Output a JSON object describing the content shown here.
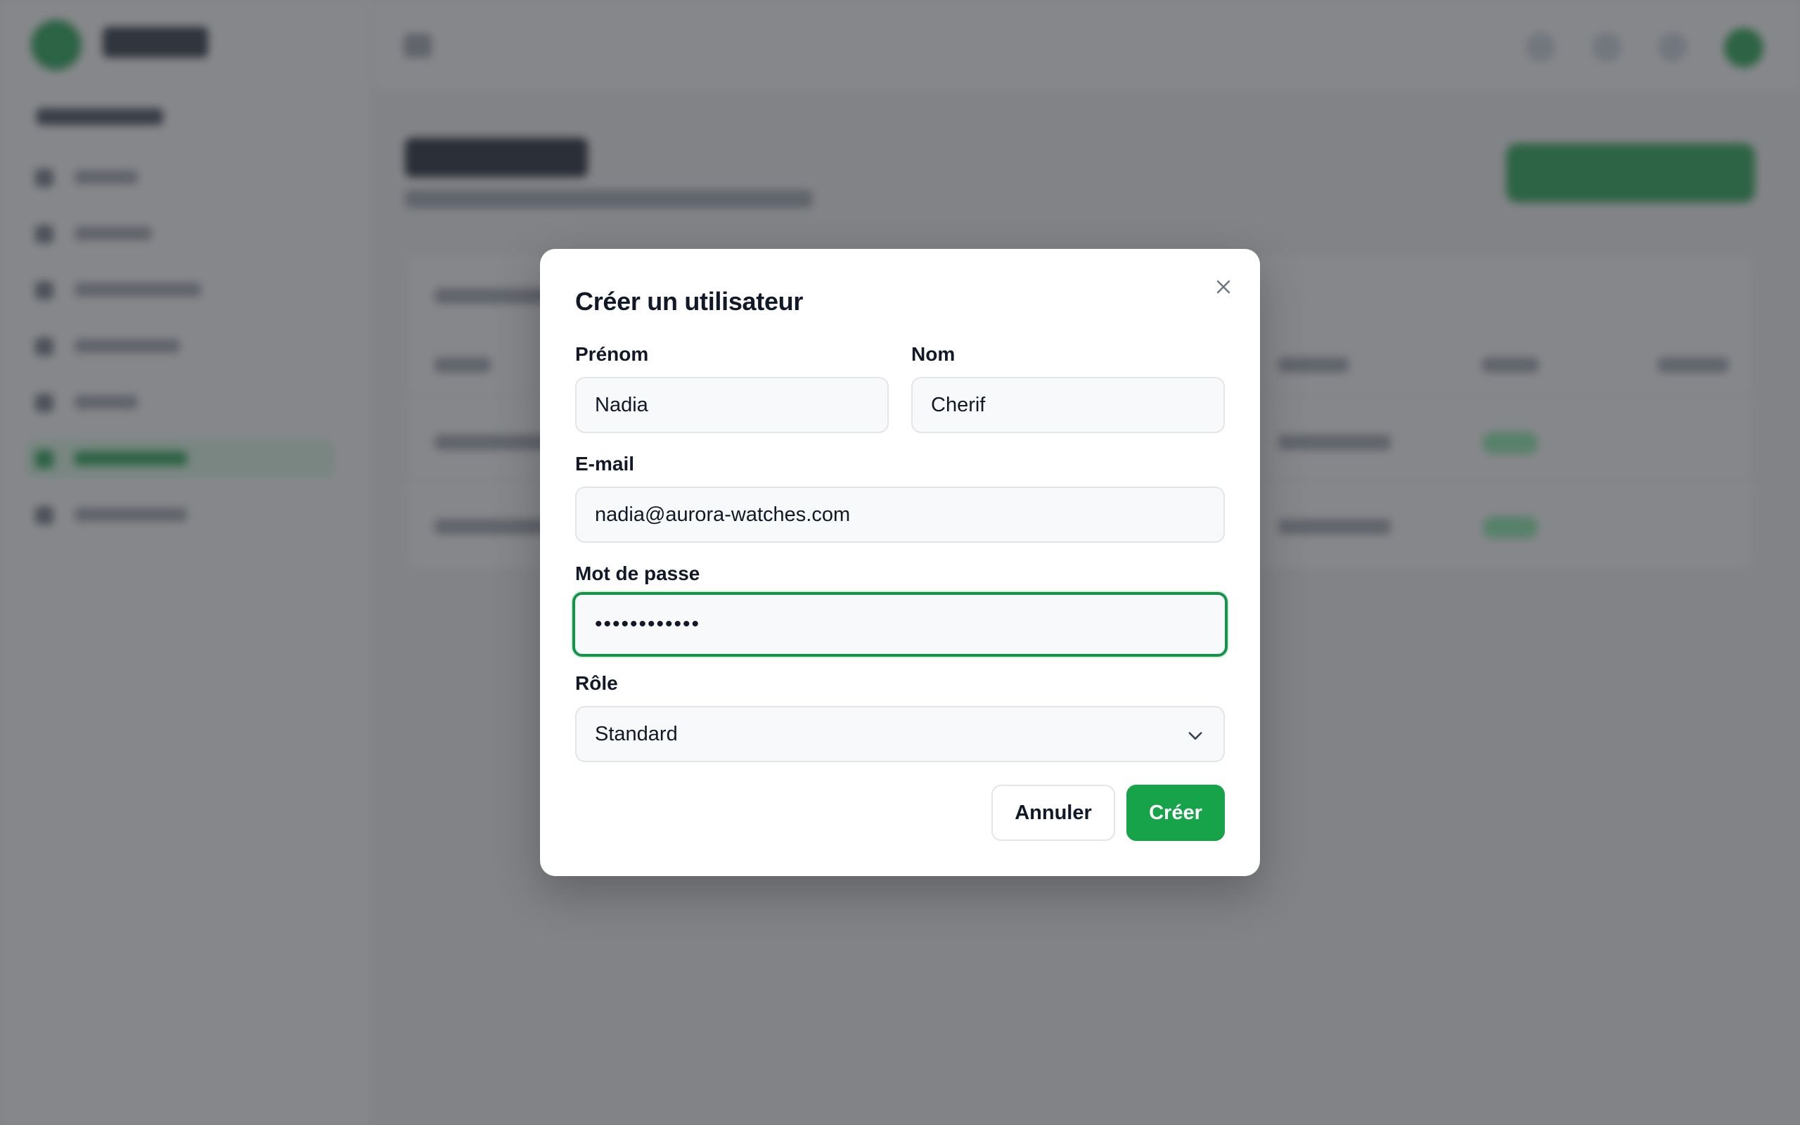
{
  "modal": {
    "title": "Créer un utilisateur",
    "fields": {
      "first_name": {
        "label": "Prénom",
        "value": "Nadia"
      },
      "last_name": {
        "label": "Nom",
        "value": "Cherif"
      },
      "email": {
        "label": "E-mail",
        "value": "nadia@aurora-watches.com"
      },
      "password": {
        "label": "Mot de passe",
        "masked_value": "••••••••••••"
      },
      "role": {
        "label": "Rôle",
        "selected": "Standard"
      }
    },
    "actions": {
      "cancel_label": "Annuler",
      "create_label": "Créer"
    },
    "icons": {
      "close": "close-icon",
      "role_dropdown": "chevron-down-icon"
    }
  },
  "colors": {
    "accent": "#16a34a",
    "focus_ring": "#15934a",
    "overlay": "#3c3e42",
    "text": "#111827"
  }
}
